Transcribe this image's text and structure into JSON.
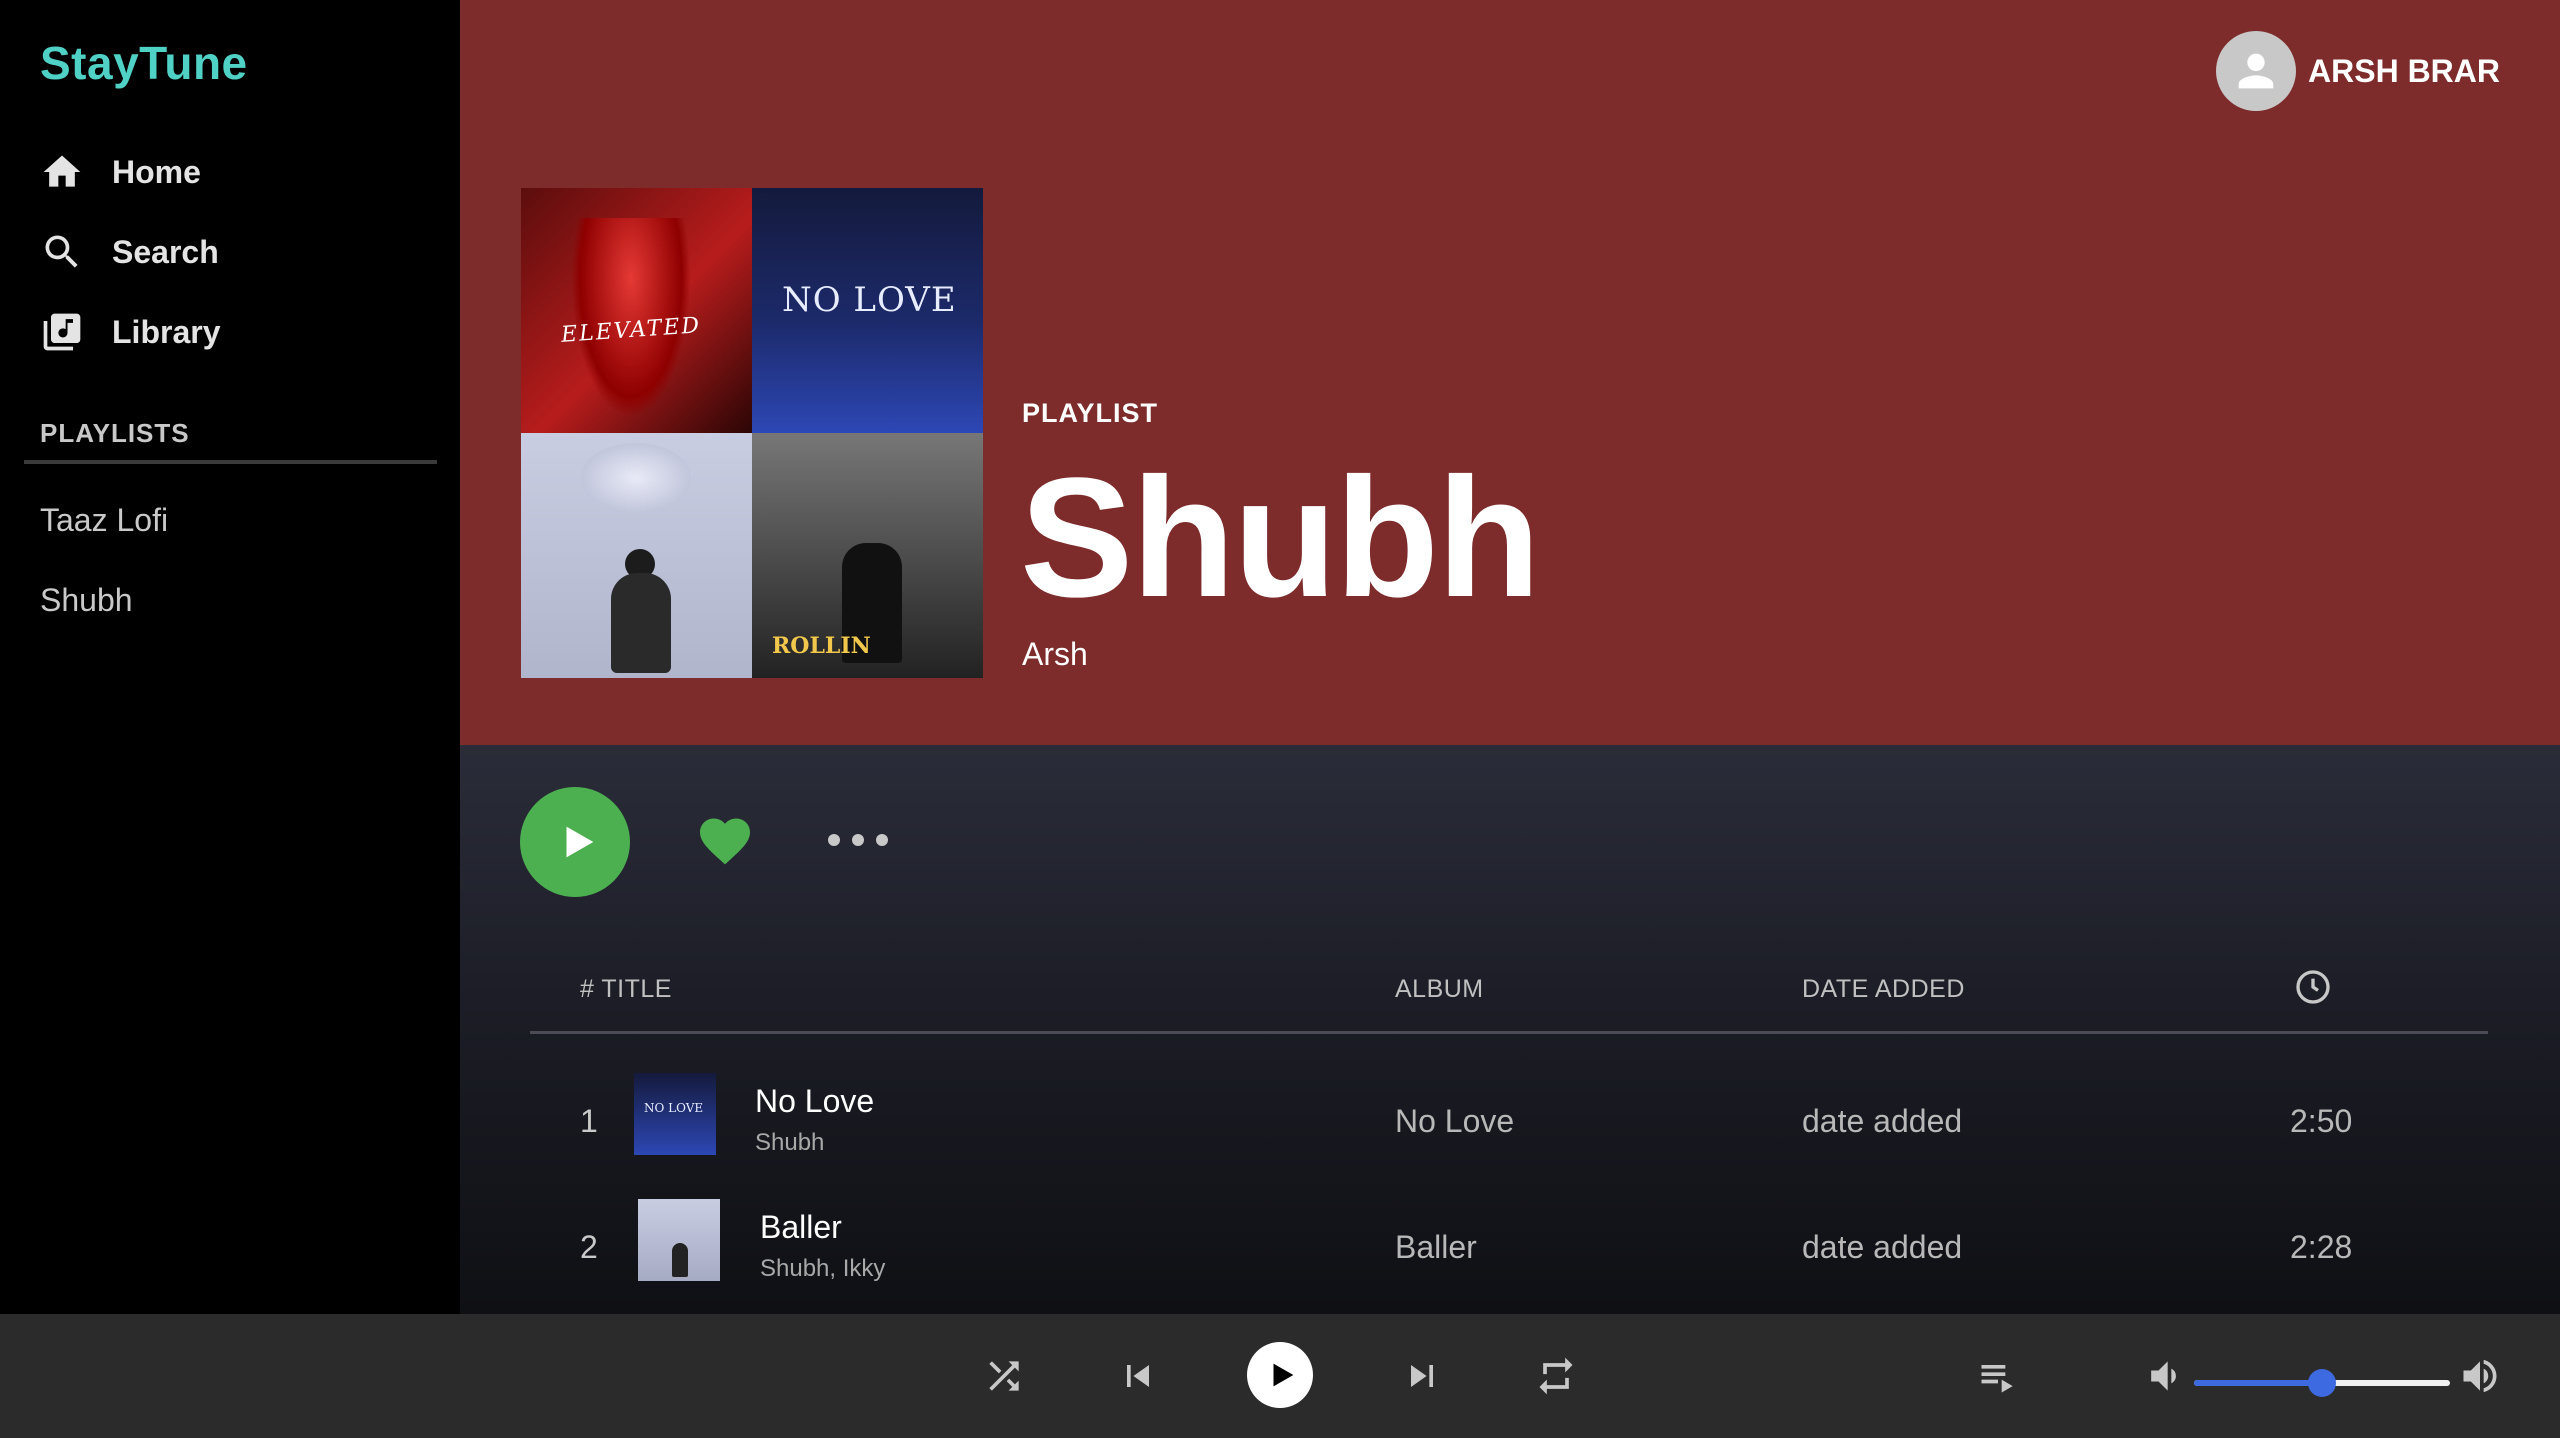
{
  "app": {
    "name": "StayTune"
  },
  "sidebar": {
    "nav": [
      {
        "label": "Home",
        "icon": "home-icon"
      },
      {
        "label": "Search",
        "icon": "search-icon"
      },
      {
        "label": "Library",
        "icon": "library-icon"
      }
    ],
    "playlists_heading": "PLAYLISTS",
    "playlists": [
      "Taaz Lofi",
      "Shubh"
    ]
  },
  "user": {
    "name": "ARSH BRAR",
    "avatar_icon": "user-avatar-icon"
  },
  "playlist": {
    "type_label": "PLAYLIST",
    "title": "Shubh",
    "owner": "Arsh",
    "cover_texts": [
      "ELEVATED",
      "NO LOVE",
      "ROLLIN"
    ],
    "header_color": "#7d2b2b"
  },
  "actions": {
    "play_icon": "play-icon",
    "like_icon": "heart-icon",
    "more_icon": "more-options-icon",
    "accent_color": "#4caf50"
  },
  "table": {
    "headers": {
      "title": "# TITLE",
      "album": "ALBUM",
      "date_added": "DATE ADDED",
      "duration_icon": "clock-icon"
    },
    "rows": [
      {
        "index": "1",
        "title": "No Love",
        "artist": "Shubh",
        "album": "No Love",
        "date_added": "date added",
        "duration": "2:50",
        "thumb_text": "NO LOVE"
      },
      {
        "index": "2",
        "title": "Baller",
        "artist": "Shubh, Ikky",
        "album": "Baller",
        "date_added": "date added",
        "duration": "2:28"
      }
    ]
  },
  "player": {
    "controls": [
      "shuffle-icon",
      "previous-icon",
      "play-icon",
      "next-icon",
      "repeat-icon"
    ],
    "queue_icon": "queue-icon",
    "volume_down_icon": "volume-down-icon",
    "volume_up_icon": "volume-up-icon",
    "volume_level": 0.5,
    "volume_color": "#3d6ae0"
  }
}
